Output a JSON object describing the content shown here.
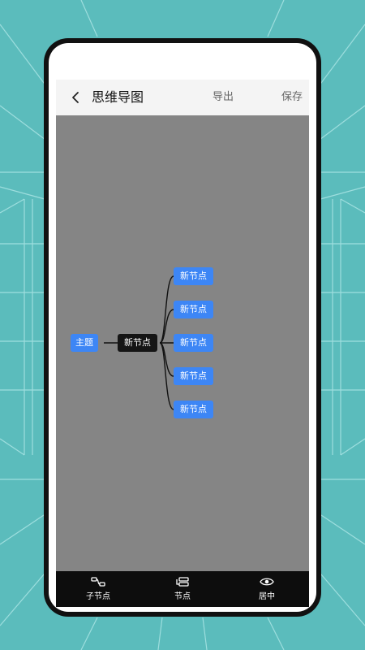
{
  "header": {
    "title": "思维导图",
    "export_label": "导出",
    "save_label": "保存"
  },
  "mindmap": {
    "root": "主题",
    "center": "新节点",
    "children": [
      "新节点",
      "新节点",
      "新节点",
      "新节点",
      "新节点"
    ]
  },
  "toolbar": {
    "child_node_label": "子节点",
    "node_label": "节点",
    "center_label": "居中"
  },
  "colors": {
    "background": "#5bbcbc",
    "node_blue": "#3d86f5",
    "node_dark": "#151515",
    "canvas": "#858585"
  },
  "icons": {
    "back": "chevron-left-icon",
    "child_node": "child-node-icon",
    "node": "node-icon",
    "center": "eye-icon"
  }
}
